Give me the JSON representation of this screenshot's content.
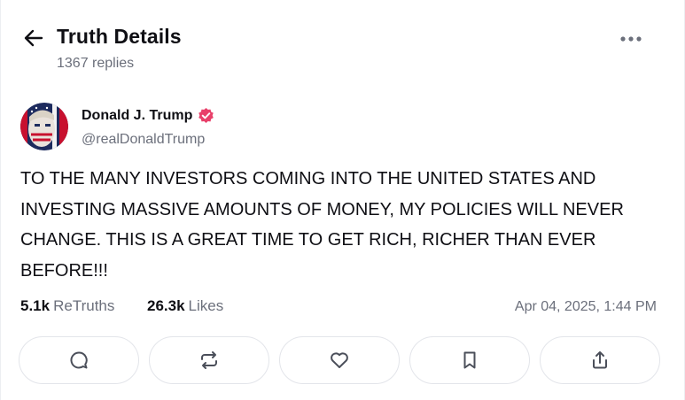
{
  "header": {
    "title": "Truth Details",
    "replies": "1367 replies",
    "back_icon": "arrow-left-icon",
    "more_icon": "more-horizontal-icon"
  },
  "author": {
    "name": "Donald J. Trump",
    "handle": "@realDonaldTrump",
    "verified": true,
    "verified_color": "#e8406a"
  },
  "post": {
    "text": "TO THE MANY INVESTORS COMING INTO THE UNITED STATES AND INVESTING MASSIVE AMOUNTS OF MONEY, MY POLICIES WILL NEVER CHANGE. THIS IS A GREAT TIME TO GET RICH, RICHER THAN EVER BEFORE!!!"
  },
  "stats": {
    "retruths_count": "5.1k",
    "retruths_label": "ReTruths",
    "likes_count": "26.3k",
    "likes_label": "Likes",
    "timestamp": "Apr 04, 2025, 1:44 PM"
  },
  "actions": [
    {
      "icon": "reply-icon"
    },
    {
      "icon": "retruth-icon"
    },
    {
      "icon": "like-icon"
    },
    {
      "icon": "bookmark-icon"
    },
    {
      "icon": "share-icon"
    }
  ],
  "colors": {
    "text": "#0f0f14",
    "muted": "#6b6f7b",
    "border": "#e3e5ea",
    "icon": "#4b4f5a"
  }
}
